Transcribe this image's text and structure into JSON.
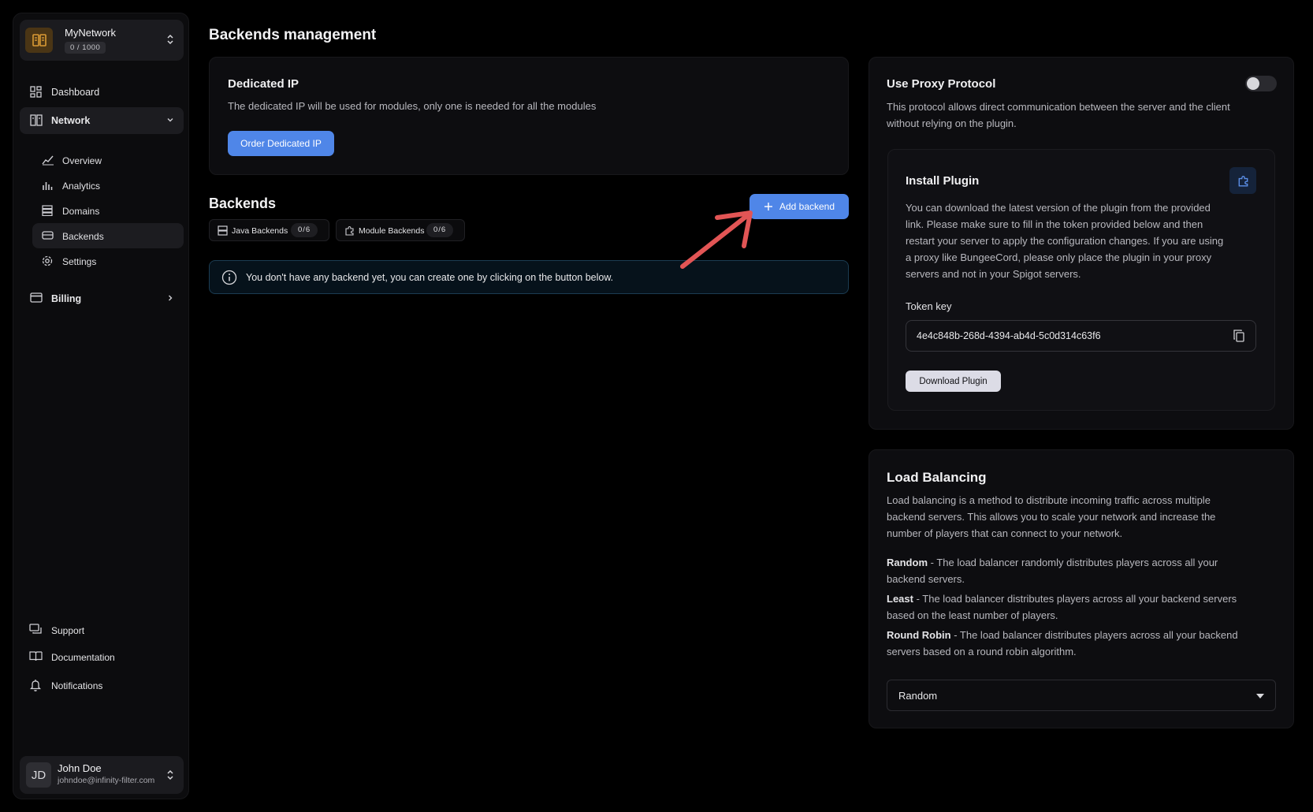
{
  "network": {
    "name": "MyNetwork",
    "count": "0 / 1000"
  },
  "nav": {
    "dashboard": "Dashboard",
    "network": "Network",
    "overview": "Overview",
    "analytics": "Analytics",
    "domains": "Domains",
    "backends": "Backends",
    "settings": "Settings",
    "billing": "Billing",
    "support": "Support",
    "documentation": "Documentation",
    "notifications": "Notifications"
  },
  "user": {
    "initials": "JD",
    "name": "John Doe",
    "email": "johndoe@infinity-filter.com"
  },
  "page": {
    "title": "Backends management"
  },
  "dedicated_ip": {
    "title": "Dedicated IP",
    "description": "The dedicated IP will be used for modules, only one is needed for all the modules",
    "button": "Order Dedicated IP"
  },
  "backends": {
    "title": "Backends",
    "add_button": "Add backend",
    "java_label": "Java Backends",
    "java_count": "0/6",
    "module_label": "Module Backends",
    "module_count": "0/6",
    "empty_message": "You don't have any backend yet, you can create one by clicking on the button below."
  },
  "proxy": {
    "title": "Use Proxy Protocol",
    "enabled": false,
    "description_1": "This protocol allows direct communication between the server and the client",
    "description_2": "without relying on the plugin."
  },
  "install_plugin": {
    "title": "Install Plugin",
    "lines": [
      "You can download the latest version of the plugin from the provided",
      "link. Please make sure to fill in the token provided below and then",
      "restart your server to apply the configuration changes. If you are using",
      "a proxy like BungeeCord, please only place the plugin in your proxy",
      "servers and not in your Spigot servers."
    ],
    "token_label": "Token key",
    "token_value": "4e4c848b-268d-4394-ab4d-5c0d314c63f6",
    "download_button": "Download Plugin"
  },
  "load_balancing": {
    "title": "Load Balancing",
    "intro": [
      "Load balancing is a method to distribute incoming traffic across multiple",
      "backend servers. This allows you to scale your network and increase the",
      "number of players that can connect to your network."
    ],
    "random_term": "Random",
    "random_desc_1": " - The load balancer randomly distributes players across all your",
    "random_desc_2": "backend servers.",
    "least_term": "Least",
    "least_desc_1": " - The load balancer distributes players across all your backend servers",
    "least_desc_2": "based on the least number of players.",
    "rr_term": "Round Robin",
    "rr_desc_1": " - The load balancer distributes players across all your backend",
    "rr_desc_2": "servers based on a round robin algorithm.",
    "selected": "Random"
  },
  "colors": {
    "accent": "#4f86e8",
    "annotation_arrow": "#e25555",
    "brand": "#d99a35"
  }
}
